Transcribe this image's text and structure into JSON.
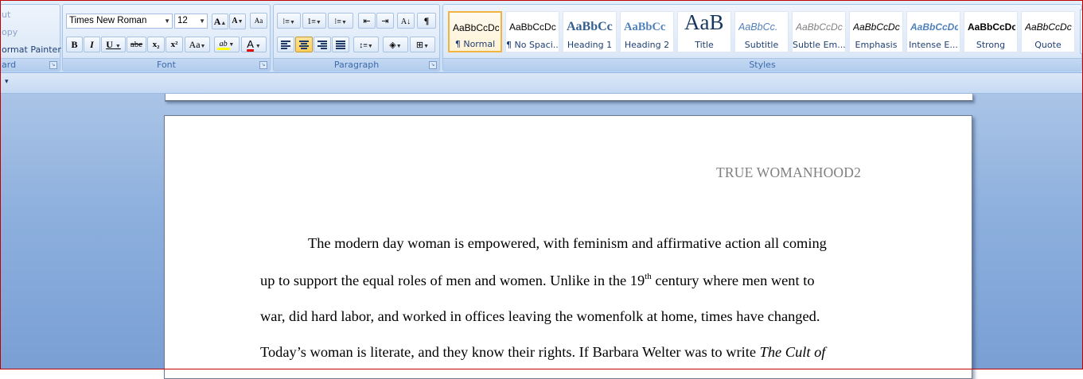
{
  "clipboard": {
    "cut": "ut",
    "copy": "opy",
    "format_painter": "ormat Painter",
    "group_label": "ard"
  },
  "font": {
    "family": "Times New Roman",
    "size": "12",
    "grow": "A",
    "shrink": "A",
    "clear": "Aa",
    "bold": "B",
    "italic": "I",
    "underline": "U",
    "strike": "abe",
    "subscript": "x₂",
    "superscript": "x²",
    "change_case": "Aa",
    "highlight": "ab",
    "color_letter": "A",
    "highlight_color": "#ffff00",
    "font_color": "#e00000",
    "group_label": "Font"
  },
  "paragraph": {
    "group_label": "Paragraph",
    "pilcrow": "¶"
  },
  "styles": {
    "group_label": "Styles",
    "items": [
      {
        "sample": "AaBbCcDc",
        "name": "¶ Normal"
      },
      {
        "sample": "AaBbCcDc",
        "name": "¶ No Spaci..."
      },
      {
        "sample": "AaBbCc",
        "name": "Heading 1"
      },
      {
        "sample": "AaBbCc",
        "name": "Heading 2"
      },
      {
        "sample": "AaB",
        "name": "Title"
      },
      {
        "sample": "AaBbCc.",
        "name": "Subtitle"
      },
      {
        "sample": "AaBbCcDc",
        "name": "Subtle Em..."
      },
      {
        "sample": "AaBbCcDc",
        "name": "Emphasis"
      },
      {
        "sample": "AaBbCcDc",
        "name": "Intense E..."
      },
      {
        "sample": "AaBbCcDc",
        "name": "Strong"
      },
      {
        "sample": "AaBbCcDc",
        "name": "Quote"
      }
    ],
    "accent_selected": "#f2b441"
  },
  "document": {
    "header": "TRUE WOMANHOOD2",
    "lines": {
      "l1": "The modern day woman is empowered, with feminism and affirmative action all coming",
      "l2_a": "up to support the equal roles of men and women.  Unlike in the 19",
      "l2_sup": "th",
      "l2_b": " century where men went to",
      "l3": "war, did hard labor, and worked in offices leaving the womenfolk at home, times have changed.",
      "l4_a": "Today’s woman is literate, and they know their rights. If Barbara Welter was to write ",
      "l4_i": "The Cult of"
    }
  }
}
